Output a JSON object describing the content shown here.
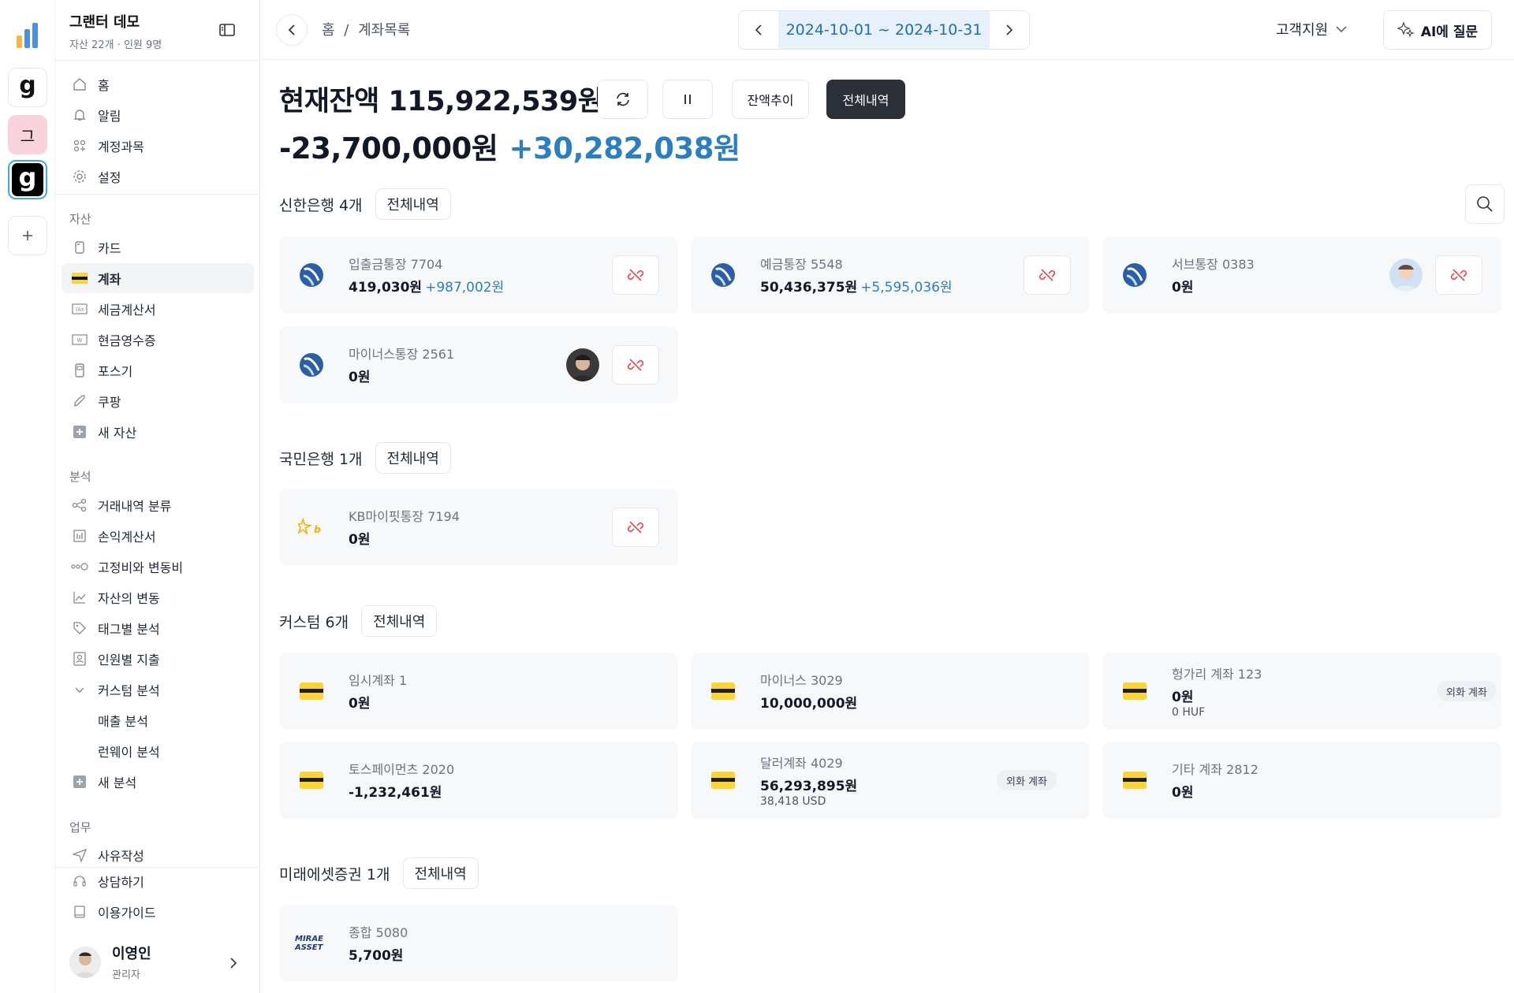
{
  "rail": {
    "ws_letter_pink": "그"
  },
  "org": {
    "name": "그랜터 데모",
    "sub": "자산 22개 · 인원 9명"
  },
  "nav_top": [
    {
      "label": "홈",
      "icon": "home-icon"
    },
    {
      "label": "알림",
      "icon": "bell-icon"
    },
    {
      "label": "계정과목",
      "icon": "grid-icon"
    },
    {
      "label": "설정",
      "icon": "gear-icon"
    }
  ],
  "sections": {
    "assets": "자산",
    "analysis": "분석",
    "work": "업무"
  },
  "nav_assets": [
    {
      "label": "카드",
      "icon": "card-icon"
    },
    {
      "label": "계좌",
      "icon": "account-icon"
    },
    {
      "label": "세금계산서",
      "icon": "tax-icon"
    },
    {
      "label": "현금영수증",
      "icon": "receipt-icon"
    },
    {
      "label": "포스기",
      "icon": "pos-icon"
    },
    {
      "label": "쿠팡",
      "icon": "rocket-icon"
    },
    {
      "label": "새 자산",
      "icon": "plus-square-icon"
    }
  ],
  "nav_analysis": [
    {
      "label": "거래내역 분류",
      "icon": "flow-icon"
    },
    {
      "label": "손익계산서",
      "icon": "ledger-icon"
    },
    {
      "label": "고정비와 변동비",
      "icon": "circles-icon"
    },
    {
      "label": "자산의 변동",
      "icon": "trend-icon"
    },
    {
      "label": "태그별 분석",
      "icon": "tag-icon"
    },
    {
      "label": "인원별 지출",
      "icon": "person-card-icon"
    },
    {
      "label": "커스텀 분석",
      "icon": "chevron-down-icon"
    },
    {
      "label": "매출 분석",
      "icon": ""
    },
    {
      "label": "런웨이 분석",
      "icon": ""
    },
    {
      "label": "새 분석",
      "icon": "plus-square-icon"
    }
  ],
  "nav_work": [
    {
      "label": "사유작성",
      "icon": "send-icon"
    }
  ],
  "nav_bottom": [
    {
      "label": "상담하기",
      "icon": "headset-icon"
    },
    {
      "label": "이용가이드",
      "icon": "book-icon"
    }
  ],
  "user": {
    "name": "이영인",
    "role": "관리자"
  },
  "topbar": {
    "breadcrumb_home": "홈",
    "breadcrumb_sep": "/",
    "breadcrumb_current": "계좌목록",
    "date_range": "2024-10-01 ~ 2024-10-31",
    "support": "고객지원",
    "ai": "AI에 질문"
  },
  "summary": {
    "balance": "현재잔액 115,922,539원",
    "outflow": "-23,700,000원",
    "inflow": "+30,282,038원",
    "btn_trend": "잔액추이",
    "btn_all": "전체내역"
  },
  "groups": [
    {
      "title": "신한은행 4개",
      "button": "전체내역"
    },
    {
      "title": "국민은행 1개",
      "button": "전체내역"
    },
    {
      "title": "커스텀 6개",
      "button": "전체내역"
    },
    {
      "title": "미래에셋증권 1개",
      "button": "전체내역"
    }
  ],
  "accounts": {
    "shinhan": [
      {
        "name": "입출금통장 7704",
        "amount": "419,030원",
        "gain": "+987,002원"
      },
      {
        "name": "예금통장 5548",
        "amount": "50,436,375원",
        "gain": "+5,595,036원"
      },
      {
        "name": "서브통장 0383",
        "amount": "0원",
        "gain": ""
      },
      {
        "name": "마이너스통장 2561",
        "amount": "0원",
        "gain": ""
      }
    ],
    "kb": [
      {
        "name": "KB마이핏통장 7194",
        "amount": "0원"
      }
    ],
    "custom": [
      {
        "name": "임시계좌 1",
        "amount": "0원",
        "sub": "",
        "fx": ""
      },
      {
        "name": "마이너스 3029",
        "amount": "10,000,000원",
        "sub": "",
        "fx": ""
      },
      {
        "name": "헝가리 계좌 123",
        "amount": "0원",
        "sub": "0 HUF",
        "fx": "외화 계좌"
      },
      {
        "name": "토스페이먼츠 2020",
        "amount": "-1,232,461원",
        "sub": "",
        "fx": ""
      },
      {
        "name": "달러계좌 4029",
        "amount": "56,293,895원",
        "sub": "38,418 USD",
        "fx": "외화 계좌"
      },
      {
        "name": "기타 계좌 2812",
        "amount": "0원",
        "sub": "",
        "fx": ""
      }
    ],
    "mirae": [
      {
        "name": "종합 5080",
        "amount": "5,700원",
        "logo_text": "MIRAE ASSET"
      }
    ]
  },
  "colors": {
    "accent_blue": "#2b7fc1",
    "dark_button": "#2a2f38",
    "unlink_red": "#e5484d",
    "chip_yellow": "#fcd535"
  }
}
